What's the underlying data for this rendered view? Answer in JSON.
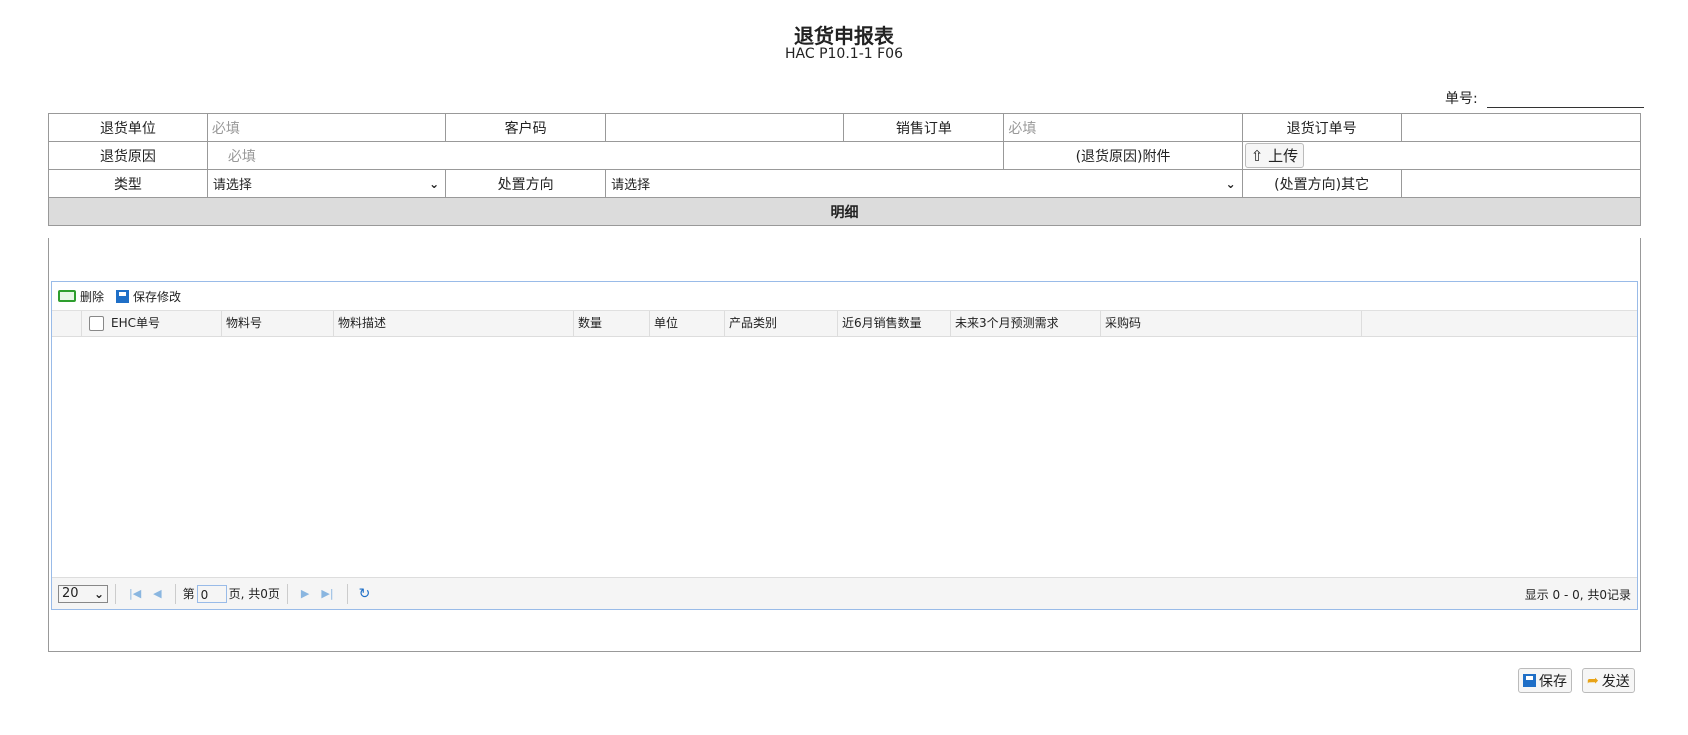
{
  "header": {
    "title": "退货申报表",
    "subtitle": "HAC P10.1-1 F06",
    "doc_no_label": "单号:"
  },
  "form": {
    "row1": {
      "return_unit_label": "退货单位",
      "return_unit_placeholder": "必填",
      "customer_code_label": "客户码",
      "sales_order_label": "销售订单",
      "sales_order_placeholder": "必填",
      "return_order_no_label": "退货订单号"
    },
    "row2": {
      "reason_label": "退货原因",
      "reason_placeholder": "必填",
      "attachment_label": "(退货原因)附件",
      "upload_label": "上传"
    },
    "row3": {
      "type_label": "类型",
      "type_value": "请选择",
      "disposal_label": "处置方向",
      "disposal_value": "请选择",
      "disposal_other_label": "(处置方向)其它"
    },
    "section_title": "明细"
  },
  "grid": {
    "toolbar": {
      "delete_label": "删除",
      "save_changes_label": "保存修改"
    },
    "columns": [
      "EHC单号",
      "物料号",
      "物料描述",
      "数量",
      "单位",
      "产品类别",
      "近6月销售数量",
      "未来3个月预测需求",
      "采购码"
    ],
    "pager": {
      "page_size": "20",
      "page_prefix": "第",
      "page_value": "0",
      "page_suffix": "页, 共0页",
      "info": "显示 0 - 0, 共0记录"
    }
  },
  "actions": {
    "save_label": "保存",
    "send_label": "发送"
  },
  "icons": [
    "upload-icon",
    "delete-icon",
    "save-icon",
    "first-page-icon",
    "prev-page-icon",
    "next-page-icon",
    "last-page-icon",
    "refresh-icon",
    "send-icon"
  ]
}
